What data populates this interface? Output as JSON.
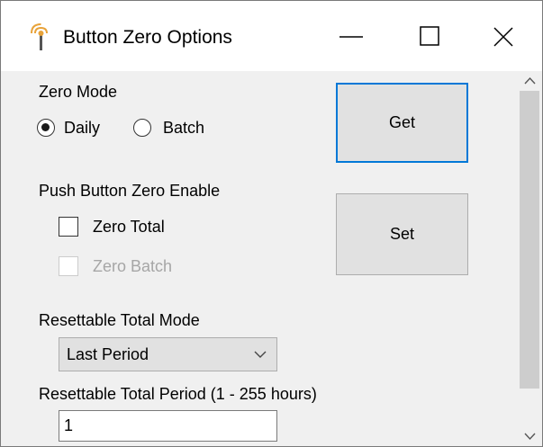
{
  "window": {
    "title": "Button Zero Options",
    "controls": {
      "minimize": "minimize-icon",
      "maximize": "maximize-icon",
      "close": "close-icon"
    }
  },
  "zero_mode": {
    "label": "Zero Mode",
    "options": [
      {
        "label": "Daily",
        "selected": true
      },
      {
        "label": "Batch",
        "selected": false
      }
    ]
  },
  "push_button_zero": {
    "label": "Push Button Zero Enable",
    "zero_total": {
      "label": "Zero Total",
      "checked": false,
      "enabled": true
    },
    "zero_batch": {
      "label": "Zero Batch",
      "checked": false,
      "enabled": false
    }
  },
  "buttons": {
    "get": "Get",
    "set": "Set"
  },
  "resettable_total_mode": {
    "label": "Resettable Total Mode",
    "selected": "Last Period"
  },
  "resettable_total_period": {
    "label": "Resettable Total Period (1 - 255 hours)",
    "value": "1"
  },
  "colors": {
    "focus_border": "#0078d7",
    "button_face": "#e1e1e1",
    "background": "#f0f0f0"
  }
}
